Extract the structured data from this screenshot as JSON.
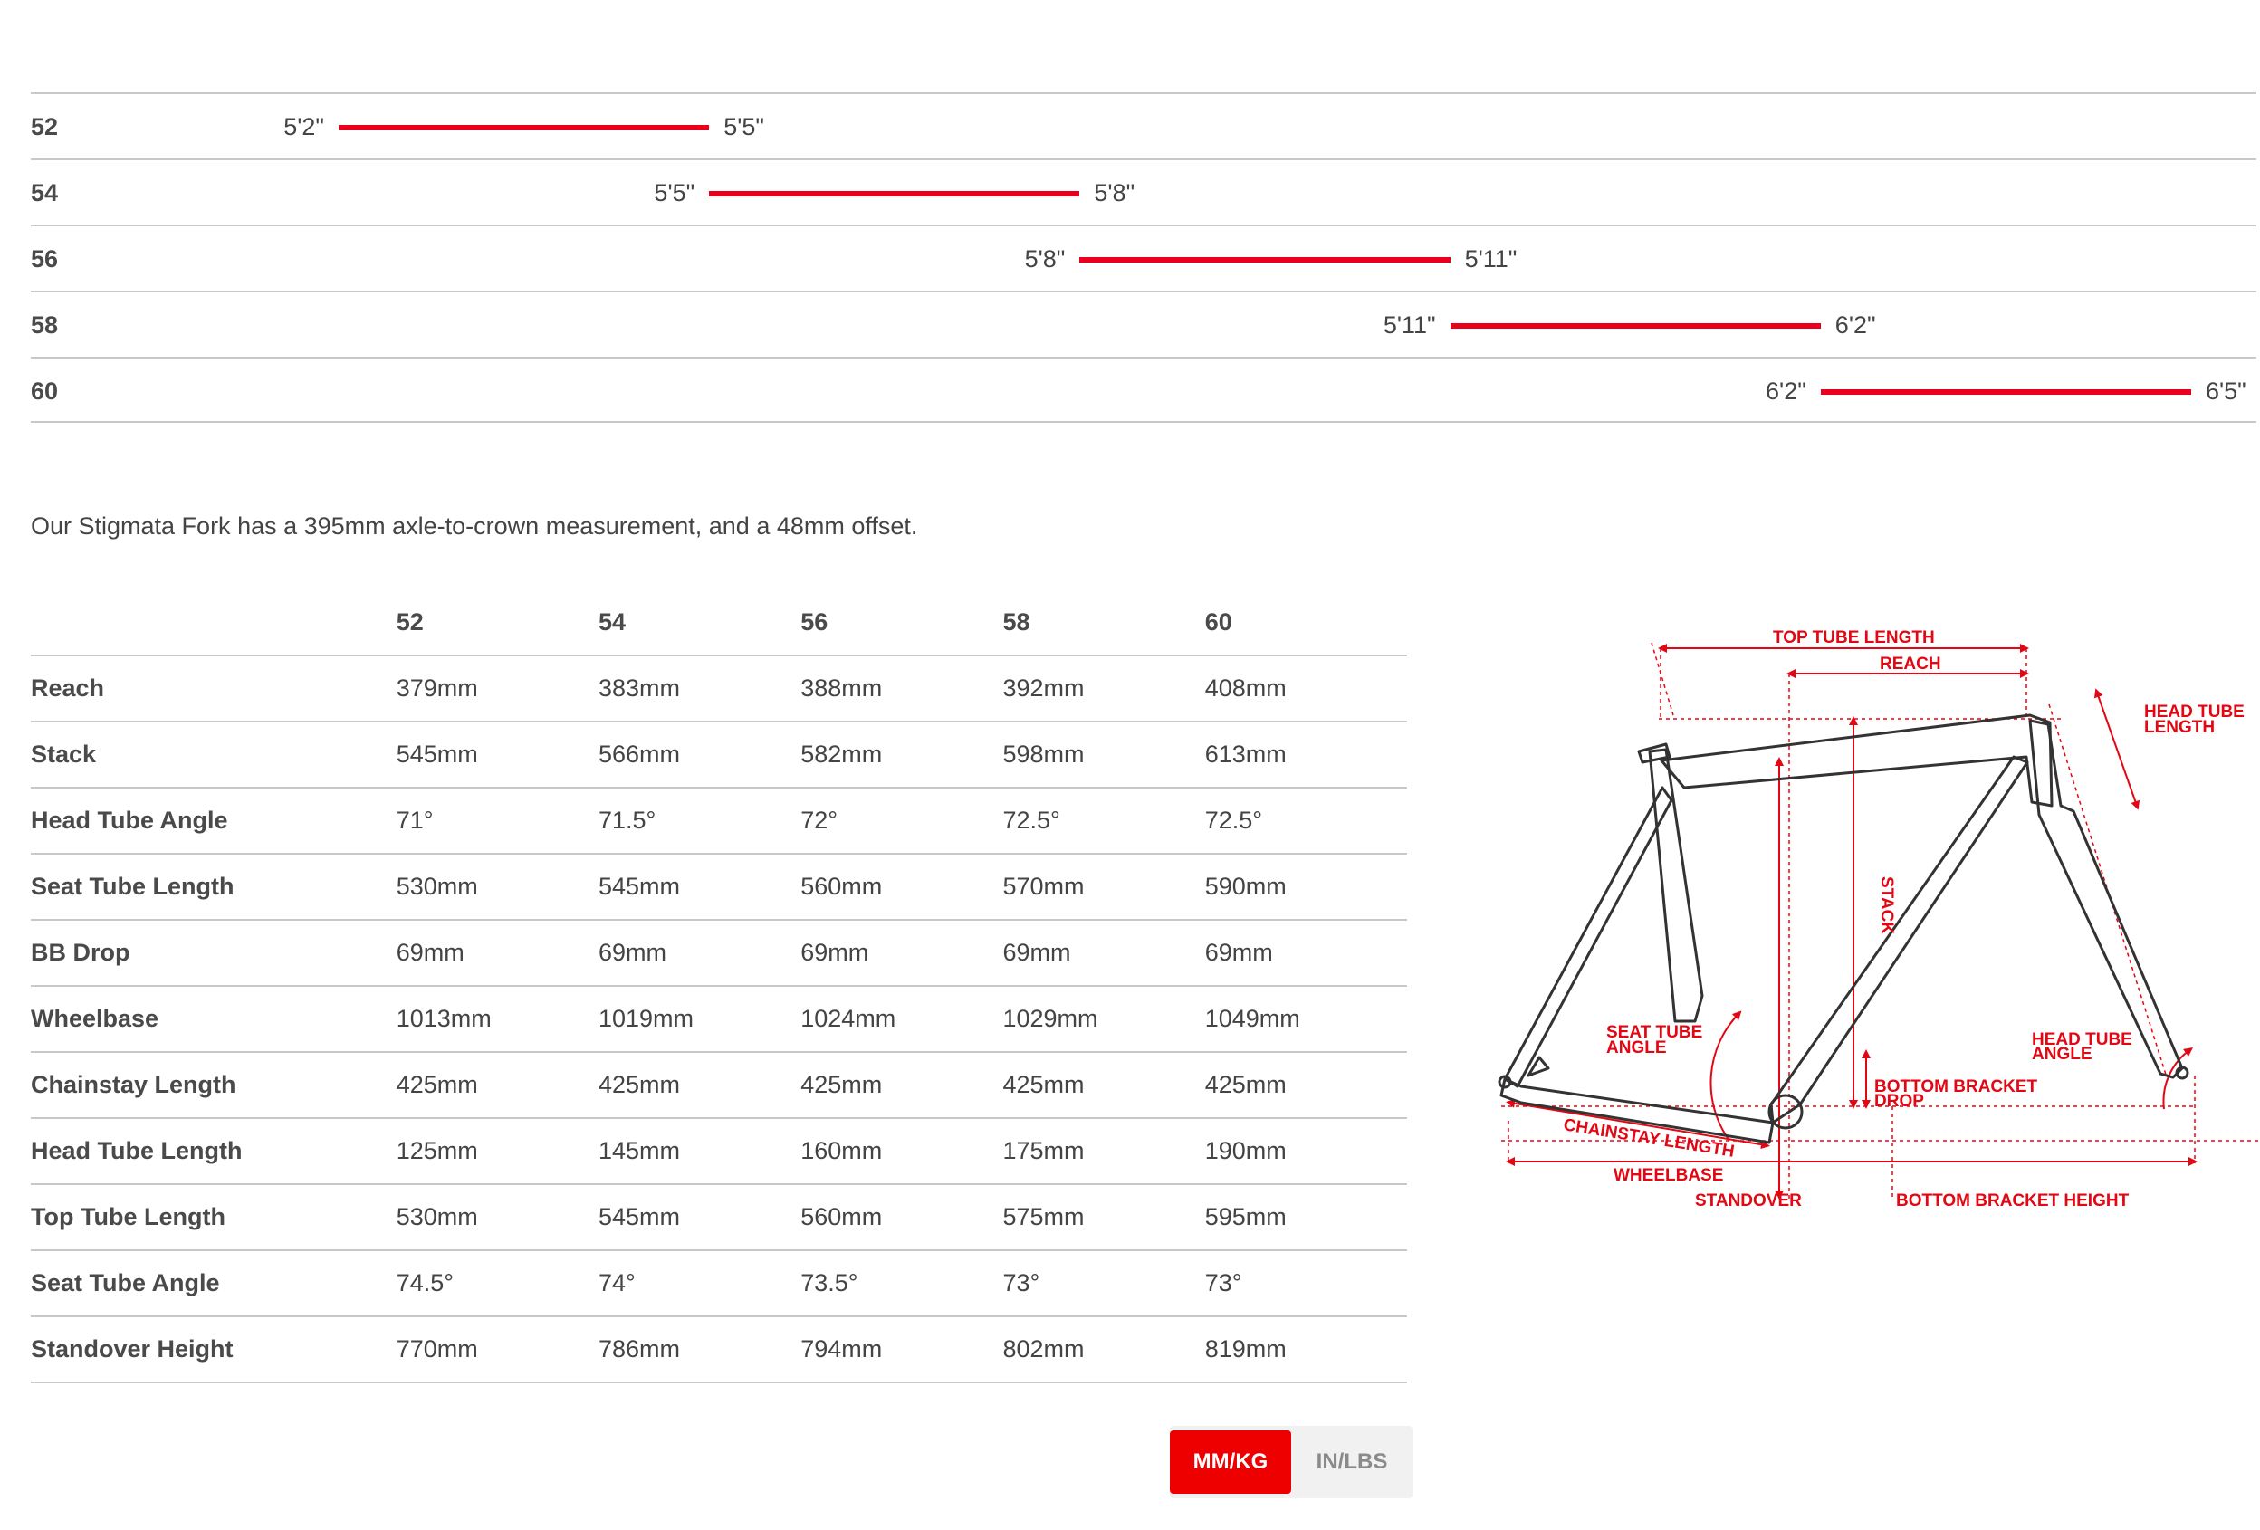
{
  "size_chart": {
    "rows": [
      {
        "size": "52",
        "min_label": "5'2\"",
        "max_label": "5'5\"",
        "min_in": 62,
        "max_in": 65
      },
      {
        "size": "54",
        "min_label": "5'5\"",
        "max_label": "5'8\"",
        "min_in": 65,
        "max_in": 68
      },
      {
        "size": "56",
        "min_label": "5'8\"",
        "max_label": "5'11\"",
        "min_in": 68,
        "max_in": 71
      },
      {
        "size": "58",
        "min_label": "5'11\"",
        "max_label": "6'2\"",
        "min_in": 71,
        "max_in": 74
      },
      {
        "size": "60",
        "min_label": "6'2\"",
        "max_label": "6'5\"",
        "min_in": 74,
        "max_in": 77
      }
    ],
    "bar_color": "#e8001c"
  },
  "fork_note": "Our Stigmata Fork has a 395mm axle-to-crown measurement, and a 48mm offset.",
  "geometry_table": {
    "sizes": [
      "52",
      "54",
      "56",
      "58",
      "60"
    ],
    "rows": [
      {
        "metric": "Reach",
        "values": [
          "379mm",
          "383mm",
          "388mm",
          "392mm",
          "408mm"
        ]
      },
      {
        "metric": "Stack",
        "values": [
          "545mm",
          "566mm",
          "582mm",
          "598mm",
          "613mm"
        ]
      },
      {
        "metric": "Head Tube Angle",
        "values": [
          "71°",
          "71.5°",
          "72°",
          "72.5°",
          "72.5°"
        ]
      },
      {
        "metric": "Seat Tube Length",
        "values": [
          "530mm",
          "545mm",
          "560mm",
          "570mm",
          "590mm"
        ]
      },
      {
        "metric": "BB Drop",
        "values": [
          "69mm",
          "69mm",
          "69mm",
          "69mm",
          "69mm"
        ]
      },
      {
        "metric": "Wheelbase",
        "values": [
          "1013mm",
          "1019mm",
          "1024mm",
          "1029mm",
          "1049mm"
        ]
      },
      {
        "metric": "Chainstay Length",
        "values": [
          "425mm",
          "425mm",
          "425mm",
          "425mm",
          "425mm"
        ]
      },
      {
        "metric": "Head Tube Length",
        "values": [
          "125mm",
          "145mm",
          "160mm",
          "175mm",
          "190mm"
        ]
      },
      {
        "metric": "Top Tube Length",
        "values": [
          "530mm",
          "545mm",
          "560mm",
          "575mm",
          "595mm"
        ]
      },
      {
        "metric": "Seat Tube Angle",
        "values": [
          "74.5°",
          "74°",
          "73.5°",
          "73°",
          "73°"
        ]
      },
      {
        "metric": "Standover Height",
        "values": [
          "770mm",
          "786mm",
          "794mm",
          "802mm",
          "819mm"
        ]
      }
    ]
  },
  "unit_toggle": {
    "mm_label": "MM/KG",
    "in_label": "IN/LBS",
    "active": "MM/KG",
    "accent": "#ee0000"
  },
  "diagram": {
    "labels": {
      "top_tube_length": "TOP TUBE LENGTH",
      "reach": "REACH",
      "head_tube_length_1": "HEAD TUBE",
      "head_tube_length_2": "LENGTH",
      "stack": "STACK",
      "seat_tube_angle_1": "SEAT TUBE",
      "seat_tube_angle_2": "ANGLE",
      "head_tube_angle_1": "HEAD TUBE",
      "head_tube_angle_2": "ANGLE",
      "bb_drop_1": "BOTTOM BRACKET",
      "bb_drop_2": "DROP",
      "chainstay_length": "CHAINSTAY LENGTH",
      "wheelbase": "WHEELBASE",
      "standover": "STANDOVER",
      "bb_height": "BOTTOM BRACKET HEIGHT"
    },
    "accent": "#e30613"
  }
}
